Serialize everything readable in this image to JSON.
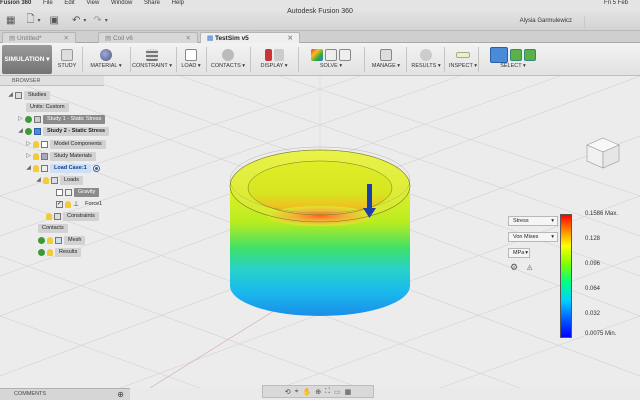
{
  "menubar": {
    "app": "Fusion 360",
    "items": [
      "File",
      "Edit",
      "View",
      "Window",
      "Share",
      "Help"
    ],
    "clock": "Fri 5 Feb"
  },
  "window": {
    "title": "Autodesk Fusion 360",
    "user": "Alysia Garmulewicz"
  },
  "tabs": [
    {
      "label": "Untitled*",
      "active": false
    },
    {
      "label": "Coil v6",
      "active": false
    },
    {
      "label": "TestSim v5",
      "active": true
    }
  ],
  "toolbar": {
    "workspace": "SIMULATION",
    "groups": [
      {
        "label": "STUDY"
      },
      {
        "label": "MATERIAL"
      },
      {
        "label": "CONSTRAINT"
      },
      {
        "label": "LOAD"
      },
      {
        "label": "CONTACTS"
      },
      {
        "label": "DISPLAY"
      },
      {
        "label": "SOLVE"
      },
      {
        "label": "MANAGE"
      },
      {
        "label": "RESULTS"
      },
      {
        "label": "INSPECT"
      },
      {
        "label": "SELECT"
      }
    ]
  },
  "browser": {
    "title": "BROWSER",
    "items": {
      "studies": "Studies",
      "units": "Units: Custom",
      "study1": "Study 1 - Static Stress",
      "study2": "Study 2 - Static Stress",
      "model_components": "Model Components",
      "study_materials": "Study Materials",
      "load_case": "Load Case:1",
      "loads": "Loads",
      "gravity": "Gravity",
      "force1": "Force1",
      "constraints": "Constraints",
      "contacts": "Contacts",
      "mesh": "Mesh",
      "results": "Results"
    }
  },
  "legend": {
    "result_type": "Stress",
    "criterion": "Von Mises",
    "unit": "MPa",
    "max_label": "0.1586 Max.",
    "ticks": [
      "0.128",
      "0.096",
      "0.064",
      "0.032"
    ],
    "min_label": "0.0075 Min."
  },
  "comments": {
    "label": "COMMENTS"
  },
  "colors": {
    "accent": "#4a8ad6",
    "sim_button": "#7f7f7f",
    "check_green": "#3b9a34"
  }
}
